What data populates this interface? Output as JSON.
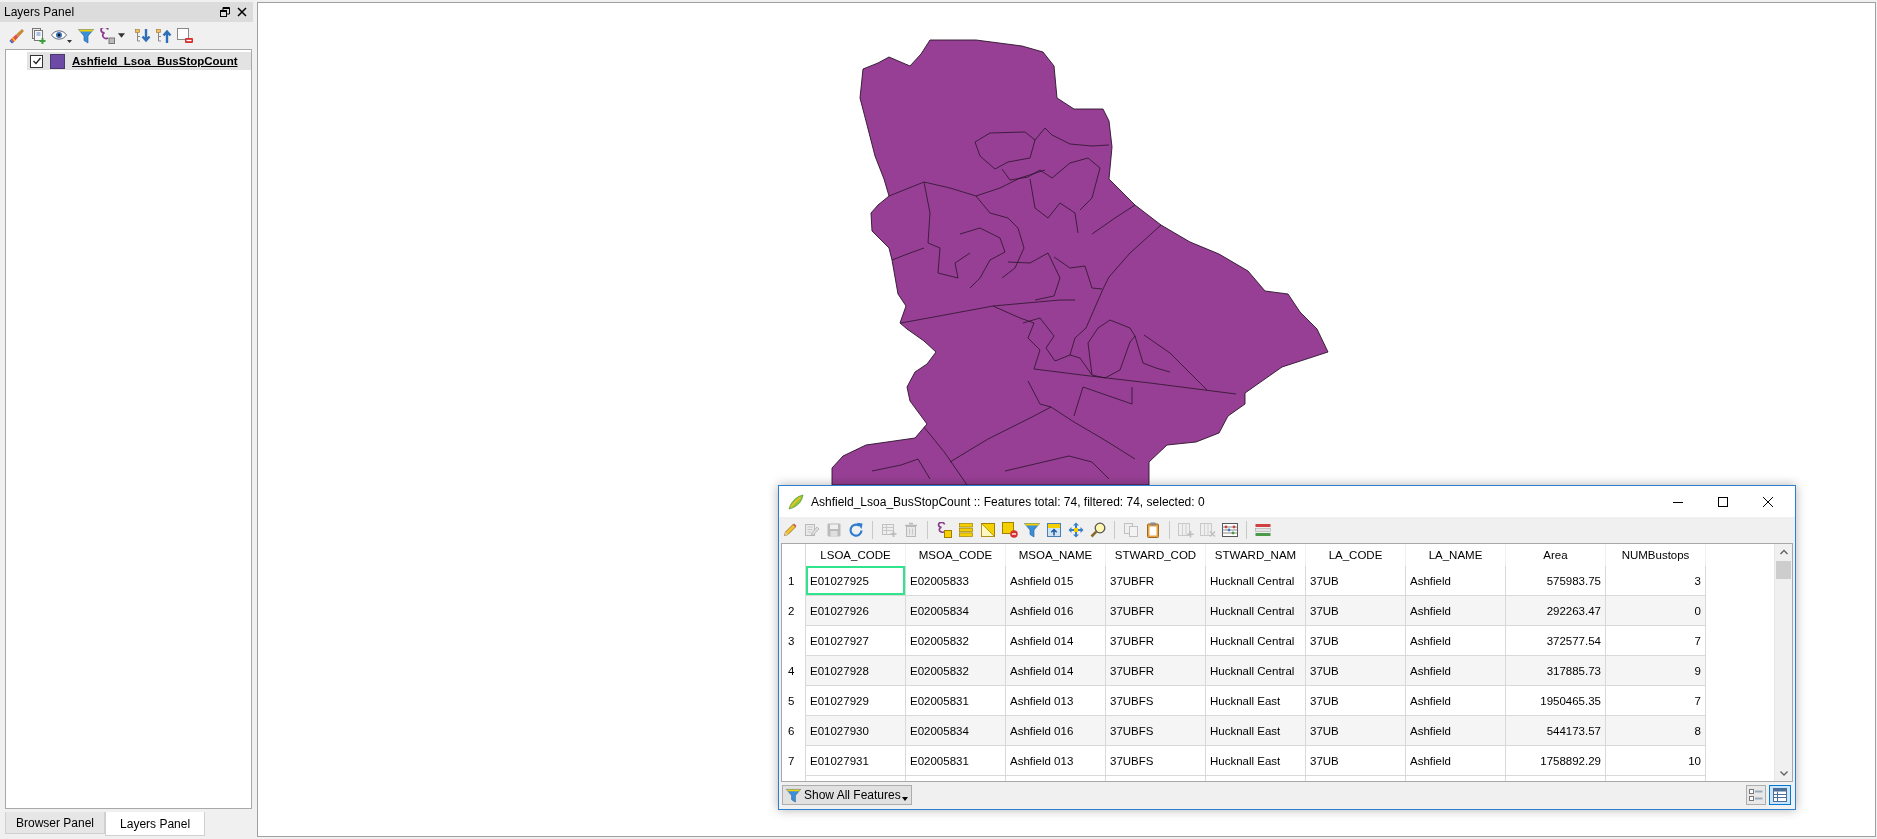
{
  "layers_panel": {
    "title": "Layers Panel",
    "layers": [
      {
        "name": "Ashfield_Lsoa_BusStopCount",
        "checked": true,
        "selected": true,
        "color": "#6c4aa6"
      }
    ]
  },
  "dock_tabs": [
    {
      "label": "Browser Panel",
      "selected": false
    },
    {
      "label": "Layers Panel",
      "selected": true
    }
  ],
  "attribute_table": {
    "title": "Ashfield_Lsoa_BusStopCount :: Features total: 74, filtered: 74, selected: 0",
    "toolbar": [
      [
        {
          "kind": "edit",
          "disabled": false
        },
        {
          "kind": "multi-edit",
          "disabled": true
        },
        {
          "kind": "save",
          "disabled": true
        },
        {
          "kind": "reload",
          "disabled": false
        }
      ],
      [
        {
          "kind": "add-row",
          "disabled": true
        },
        {
          "kind": "delete",
          "disabled": true
        }
      ],
      [
        {
          "kind": "select-expression",
          "disabled": false
        },
        {
          "kind": "select-all",
          "disabled": false
        },
        {
          "kind": "invert-selection",
          "disabled": false
        },
        {
          "kind": "deselect",
          "disabled": false
        },
        {
          "kind": "filter",
          "disabled": false
        },
        {
          "kind": "move-to-top",
          "disabled": false
        },
        {
          "kind": "pan",
          "disabled": false
        },
        {
          "kind": "zoom",
          "disabled": false
        }
      ],
      [
        {
          "kind": "copy",
          "disabled": true
        },
        {
          "kind": "paste",
          "disabled": false
        }
      ],
      [
        {
          "kind": "new-field",
          "disabled": true
        },
        {
          "kind": "delete-field",
          "disabled": true
        },
        {
          "kind": "field-calculator",
          "disabled": false
        }
      ],
      [
        {
          "kind": "conditional-format",
          "disabled": false
        }
      ]
    ],
    "columns": [
      {
        "label": "LSOA_CODE",
        "kind": "text"
      },
      {
        "label": "MSOA_CODE",
        "kind": "text"
      },
      {
        "label": "MSOA_NAME",
        "kind": "text"
      },
      {
        "label": "STWARD_COD",
        "kind": "text"
      },
      {
        "label": "STWARD_NAM",
        "kind": "text"
      },
      {
        "label": "LA_CODE",
        "kind": "text"
      },
      {
        "label": "LA_NAME",
        "kind": "text"
      },
      {
        "label": "Area",
        "kind": "number"
      },
      {
        "label": "NUMBustops",
        "kind": "number"
      }
    ],
    "rows": [
      {
        "number": "1",
        "focused": true,
        "cells": [
          "E01027925",
          "E02005833",
          "Ashfield 015",
          "37UBFR",
          "Hucknall Central",
          "37UB",
          "Ashfield",
          "575983.75",
          "3"
        ]
      },
      {
        "number": "2",
        "focused": false,
        "cells": [
          "E01027926",
          "E02005834",
          "Ashfield 016",
          "37UBFR",
          "Hucknall Central",
          "37UB",
          "Ashfield",
          "292263.47",
          "0"
        ]
      },
      {
        "number": "3",
        "focused": false,
        "cells": [
          "E01027927",
          "E02005832",
          "Ashfield 014",
          "37UBFR",
          "Hucknall Central",
          "37UB",
          "Ashfield",
          "372577.54",
          "7"
        ]
      },
      {
        "number": "4",
        "focused": false,
        "cells": [
          "E01027928",
          "E02005832",
          "Ashfield 014",
          "37UBFR",
          "Hucknall Central",
          "37UB",
          "Ashfield",
          "317885.73",
          "9"
        ]
      },
      {
        "number": "5",
        "focused": false,
        "cells": [
          "E01027929",
          "E02005831",
          "Ashfield 013",
          "37UBFS",
          "Hucknall East",
          "37UB",
          "Ashfield",
          "1950465.35",
          "7"
        ]
      },
      {
        "number": "6",
        "focused": false,
        "cells": [
          "E01027930",
          "E02005834",
          "Ashfield 016",
          "37UBFS",
          "Hucknall East",
          "37UB",
          "Ashfield",
          "544173.57",
          "8"
        ]
      },
      {
        "number": "7",
        "focused": false,
        "cells": [
          "E01027931",
          "E02005831",
          "Ashfield 013",
          "37UBFS",
          "Hucknall East",
          "37UB",
          "Ashfield",
          "1758892.29",
          "10"
        ]
      }
    ],
    "filter_button": "Show All Features",
    "view_modes": [
      {
        "kind": "form",
        "selected": false
      },
      {
        "kind": "table",
        "selected": true
      }
    ]
  }
}
